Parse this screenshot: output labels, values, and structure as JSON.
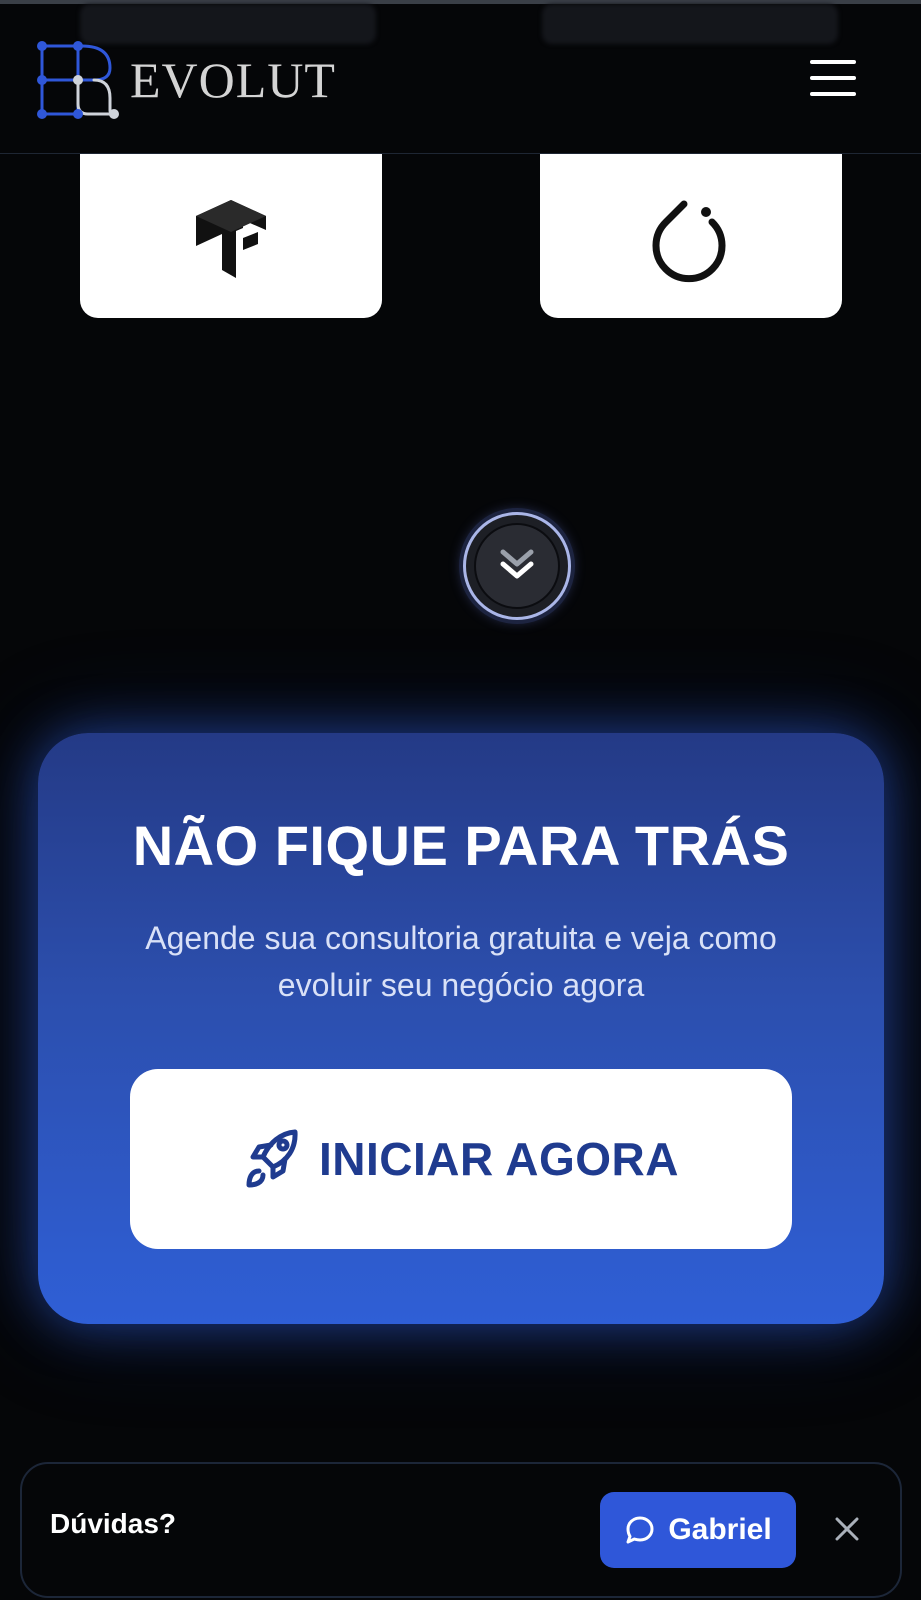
{
  "header": {
    "brand_name": "EVOLUT",
    "logo_icon": "evolut-logo-icon",
    "menu_icon": "hamburger-menu-icon"
  },
  "tech_logos": [
    {
      "icon": "tensorflow-logo-icon"
    },
    {
      "icon": "pytorch-logo-icon"
    }
  ],
  "scroll_button": {
    "icon": "chevron-double-down-icon"
  },
  "cta": {
    "title": "NÃO FIQUE PARA TRÁS",
    "subtitle": "Agende sua consultoria gratuita e veja como evoluir seu negócio agora",
    "button_label": "INICIAR AGORA",
    "button_icon": "rocket-icon"
  },
  "chat": {
    "question": "Dúvidas?",
    "button_label": "Gabriel",
    "button_icon": "chat-bubble-icon",
    "close_icon": "close-icon"
  },
  "colors": {
    "background": "#050608",
    "accent": "#2f57d9",
    "cta_gradient_top": "#243a86",
    "cta_gradient_bottom": "#2f5fd6",
    "button_text": "#1f3b8f"
  }
}
